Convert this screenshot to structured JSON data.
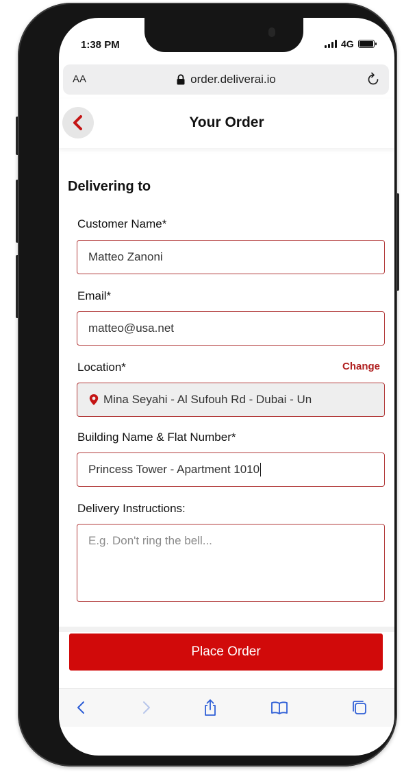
{
  "status_bar": {
    "time": "1:38 PM",
    "network": "4G"
  },
  "browser": {
    "text_size_label": "AA",
    "url": "order.deliverai.io"
  },
  "header": {
    "title": "Your Order"
  },
  "form": {
    "section_title": "Delivering to",
    "customer_name": {
      "label": "Customer Name*",
      "value": "Matteo Zanoni"
    },
    "email": {
      "label": "Email*",
      "value": "matteo@usa.net"
    },
    "location": {
      "label": "Location*",
      "change_label": "Change",
      "value": "Mina Seyahi - Al Sufouh Rd - Dubai - Un"
    },
    "building": {
      "label": "Building Name & Flat Number*",
      "value": "Princess Tower - Apartment 1010"
    },
    "instructions": {
      "label": "Delivery Instructions:",
      "placeholder": "E.g. Don't ring the bell..."
    }
  },
  "actions": {
    "place_order_label": "Place Order"
  },
  "colors": {
    "accent": "#d10a0a",
    "field_border": "#b23a3a",
    "toolbar_icon": "#2f5fd6"
  },
  "icons": {
    "back": "chevron-left-icon",
    "lock": "lock-icon",
    "reload": "reload-icon",
    "location": "location-pin-icon",
    "toolbar": [
      "back-arrow-icon",
      "forward-arrow-icon",
      "share-icon",
      "bookmarks-icon",
      "tabs-icon"
    ]
  }
}
